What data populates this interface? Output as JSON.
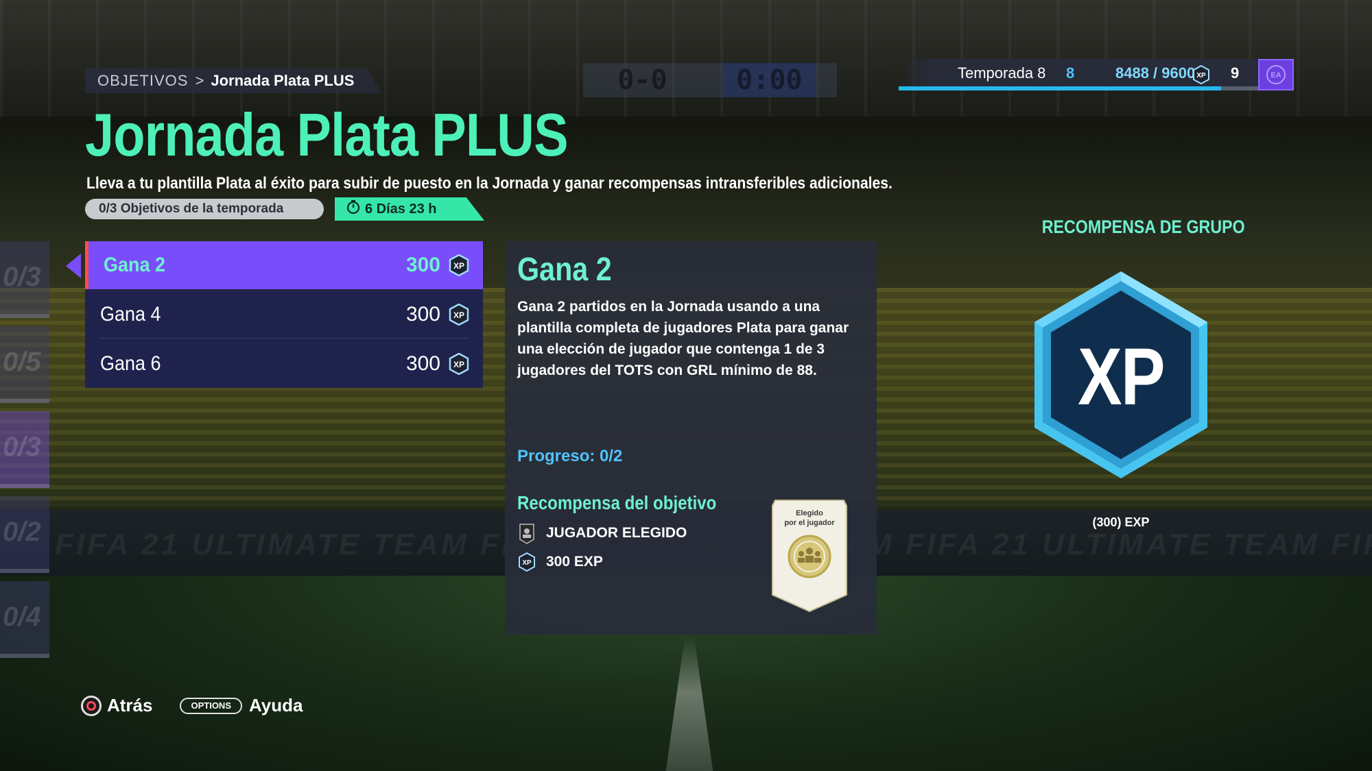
{
  "header": {
    "breadcrumb_root": "OBJETIVOS",
    "breadcrumb_separator": ">",
    "breadcrumb_current": "Jornada Plata PLUS",
    "scoreboard_score": "0-0",
    "scoreboard_time": "0:00"
  },
  "season": {
    "label": "Temporada 8",
    "current_level": "8",
    "xp_progress": "8488 / 9600",
    "xp_fraction": 0.884,
    "next_level": "9",
    "xp_icon": "xp-icon",
    "badge_icon": "ea-logo-icon"
  },
  "main": {
    "title": "Jornada Plata PLUS",
    "subtitle": "Lleva a tu plantilla Plata al éxito para subir de puesto en la Jornada y ganar recompensas intransferibles adicionales.",
    "objectives_count": "0/3 Objetivos de la temporada",
    "timer": "6 Días 23 h",
    "timer_icon": "clock-icon"
  },
  "objectives": [
    {
      "name": "Gana 2",
      "xp": "300",
      "selected": true
    },
    {
      "name": "Gana 4",
      "xp": "300",
      "selected": false
    },
    {
      "name": "Gana 6",
      "xp": "300",
      "selected": false
    }
  ],
  "side_cards": [
    "0/3",
    "0/5",
    "0/3",
    "0/2",
    "0/4"
  ],
  "detail": {
    "title": "Gana 2",
    "description": "Gana 2 partidos en la Jornada usando a una plantilla completa de jugadores Plata para ganar una elección de jugador que contenga 1 de 3 jugadores del TOTS con GRL mínimo de 88.",
    "progress": "Progreso: 0/2",
    "reward_title": "Recompensa del objetivo",
    "rewards": [
      {
        "label": "JUGADOR ELEGIDO",
        "icon": "player-pick-icon"
      },
      {
        "label": "300 EXP",
        "icon": "xp-icon"
      }
    ],
    "card_text_line1": "Elegido",
    "card_text_line2": "por el jugador"
  },
  "group_reward": {
    "title": "RECOMPENSA DE GRUPO",
    "badge_text": "XP",
    "caption": "(300) EXP"
  },
  "footer": {
    "back_label": "Atrás",
    "options_label": "OPTIONS",
    "help_label": "Ayuda"
  },
  "background": {
    "watermark": "FIFA 21 ULTIMATE TEAM      FIFA 21 ULTIMATE TEAM      FIFA 21 ULTIMATE TEAM      FIFA 21 UL"
  },
  "colors": {
    "accent_mint": "#4df0b8",
    "accent_purple": "#7a4dfa",
    "accent_blue": "#27b8ee",
    "list_bg": "#1c2050",
    "panel_bg": "#282c3a"
  }
}
